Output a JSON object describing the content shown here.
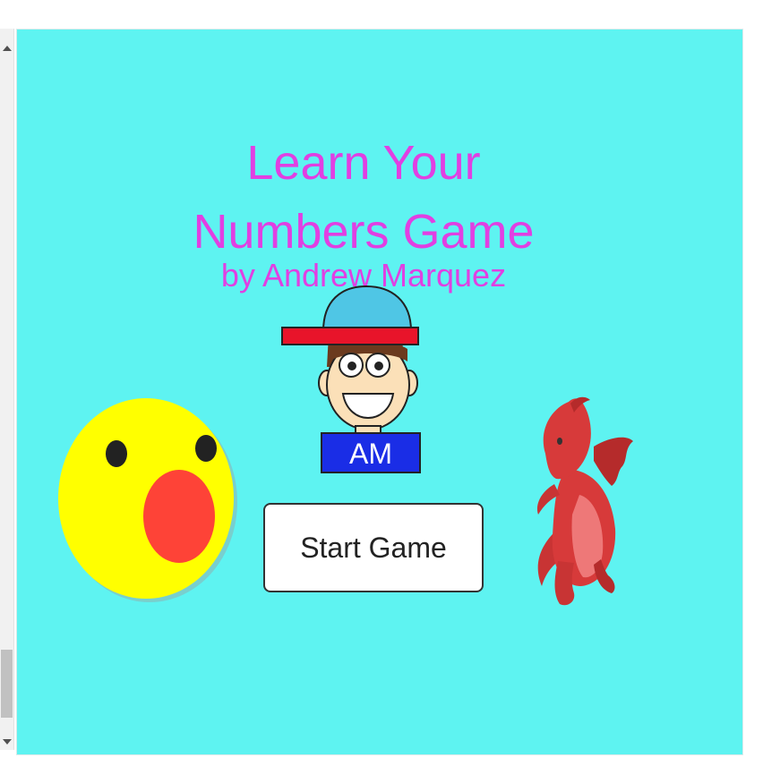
{
  "game": {
    "title_line1": "Learn Your",
    "title_line2": "Numbers Game",
    "subtitle": "by Andrew Marquez",
    "start_button_label": "Start Game",
    "badge_text": "AM"
  },
  "sprites": {
    "left": "surprised-face-icon",
    "center": "boy-with-cap-icon",
    "right": "red-dragon-icon"
  },
  "colors": {
    "background": "#5ef3f1",
    "title": "#e13fe2",
    "badge": "#1a2de6",
    "cap_brim": "#e8142a",
    "cap": "#4fc6e5",
    "smiley": "#ffff00",
    "mouth": "#fe4337",
    "dragon": "#d73a3a"
  }
}
